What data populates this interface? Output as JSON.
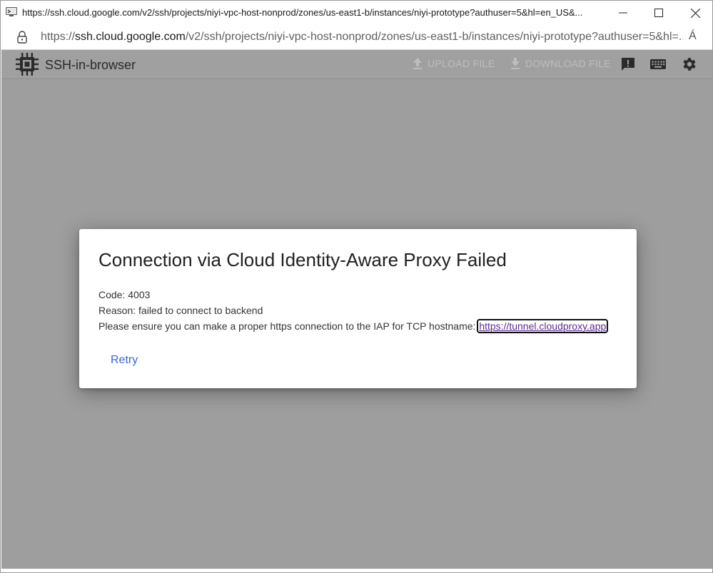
{
  "window": {
    "title": "https://ssh.cloud.google.com/v2/ssh/projects/niyi-vpc-host-nonprod/zones/us-east1-b/instances/niyi-prototype?authuser=5&hl=en_US&..."
  },
  "address_bar": {
    "scheme": "https://",
    "host": "ssh.cloud.google.com",
    "path": "/v2/ssh/projects/niyi-vpc-host-nonprod/zones/us-east1-b/instances/niyi-prototype?authuser=5&hl=...",
    "read_aloud_label": "Á"
  },
  "app": {
    "brand": "SSH-in-browser",
    "upload_label": "UPLOAD FILE",
    "download_label": "DOWNLOAD FILE"
  },
  "dialog": {
    "title": "Connection via Cloud Identity-Aware Proxy Failed",
    "code_line": "Code: 4003",
    "reason_line": "Reason: failed to connect to backend",
    "ensure_text": "Please ensure you can make a proper https connection to the IAP for TCP hostname: ",
    "link_text": "https://tunnel.cloudproxy.app",
    "retry_label": "Retry"
  },
  "colors": {
    "overlay": "#9e9e9e",
    "link": "#5c2d91",
    "retry": "#3367d6"
  }
}
